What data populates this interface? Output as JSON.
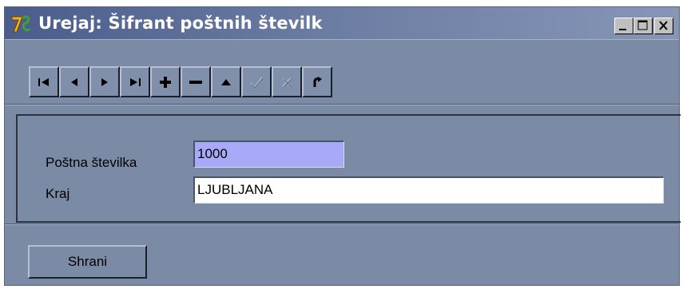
{
  "window": {
    "title": "Urejaj: Šifrant poštnih številk",
    "app_icon": "delphi-7-icon",
    "controls": [
      "minimize-icon",
      "maximize-icon",
      "close-icon"
    ]
  },
  "toolbar": {
    "buttons": [
      {
        "name": "first-record",
        "icon": "first-icon",
        "enabled": true
      },
      {
        "name": "prior-record",
        "icon": "prior-icon",
        "enabled": true
      },
      {
        "name": "next-record",
        "icon": "next-icon",
        "enabled": true
      },
      {
        "name": "last-record",
        "icon": "last-icon",
        "enabled": true
      },
      {
        "name": "insert-record",
        "icon": "plus-icon",
        "enabled": true
      },
      {
        "name": "delete-record",
        "icon": "minus-icon",
        "enabled": true
      },
      {
        "name": "edit-record",
        "icon": "up-triangle-icon",
        "enabled": true
      },
      {
        "name": "post-record",
        "icon": "checkmark-icon",
        "enabled": false
      },
      {
        "name": "cancel-record",
        "icon": "x-icon",
        "enabled": false
      },
      {
        "name": "refresh-record",
        "icon": "refresh-icon",
        "enabled": true
      }
    ]
  },
  "form": {
    "postal_code_label": "Poštna številka",
    "postal_code_value": "1000",
    "city_label": "Kraj",
    "city_value": "LJUBLJANA"
  },
  "footer": {
    "save_label": "Shrani"
  },
  "colors": {
    "window_bg": "#7b8aa5",
    "titlebar_start": "#4a5c8c",
    "focused_field_bg": "#a9a9f9",
    "field_bg": "#ffffff"
  }
}
